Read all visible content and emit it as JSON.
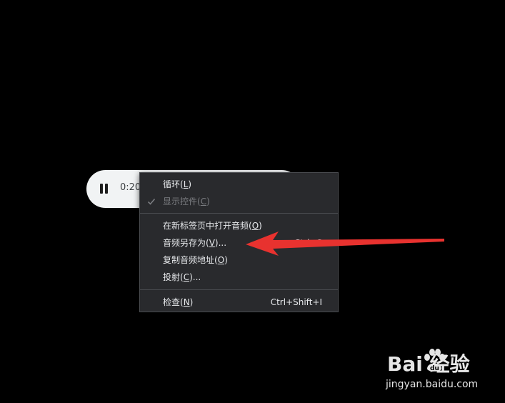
{
  "audio_player": {
    "time_display": "0:20",
    "control_icon": "pause-icon"
  },
  "context_menu": {
    "items": [
      {
        "label": "循环(",
        "mnemonic": "L",
        "label_end": ")",
        "checked": false,
        "disabled": false
      },
      {
        "label": "显示控件(",
        "mnemonic": "C",
        "label_end": ")",
        "checked": true,
        "disabled": true
      },
      {
        "label": "在新标签页中打开音频(",
        "mnemonic": "O",
        "label_end": ")",
        "checked": false,
        "disabled": false
      },
      {
        "label": "音频另存为(",
        "mnemonic": "V",
        "label_end": ")...",
        "shortcut": "Ctrl+S",
        "checked": false,
        "disabled": false
      },
      {
        "label": "复制音频地址(",
        "mnemonic": "O",
        "label_end": ")",
        "checked": false,
        "disabled": false
      },
      {
        "label": "投射(",
        "mnemonic": "C",
        "label_end": ")...",
        "checked": false,
        "disabled": false
      },
      {
        "label": "检查(",
        "mnemonic": "N",
        "label_end": ")",
        "shortcut": "Ctrl+Shift+I",
        "checked": false,
        "disabled": false
      }
    ]
  },
  "annotation": {
    "arrow_color": "#e8322f"
  },
  "watermark": {
    "brand_text": "Bai  经验",
    "url": "jingyan.baidu.com"
  },
  "colors": {
    "background": "#000000",
    "menu_bg": "#292a2d",
    "menu_text": "#e8eaed",
    "menu_disabled": "#7a7c80",
    "player_bg": "#f1f3f4"
  }
}
